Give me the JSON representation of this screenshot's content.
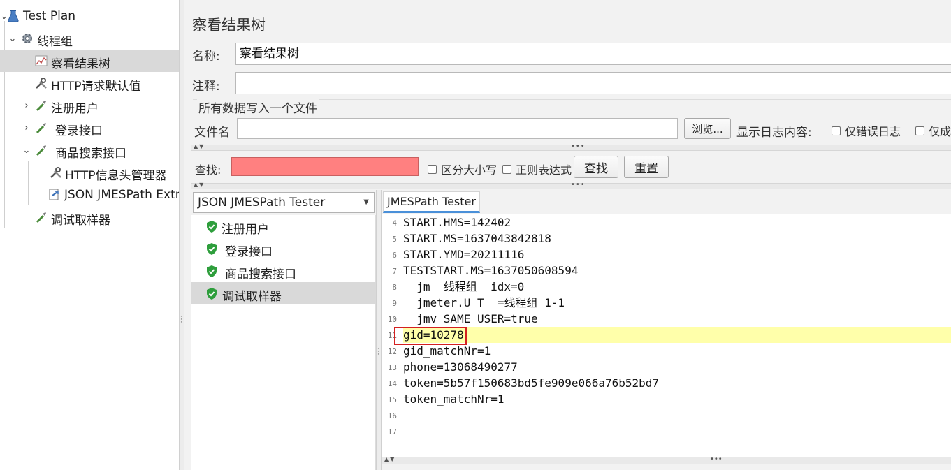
{
  "tree": {
    "items": [
      {
        "label": "Test Plan",
        "icon": "flask-icon"
      },
      {
        "label": "线程组",
        "icon": "gear-icon"
      },
      {
        "label": "察看结果树",
        "icon": "graph-icon"
      },
      {
        "label": "HTTP请求默认值",
        "icon": "wrench-icon"
      },
      {
        "label": "注册用户",
        "icon": "pipette-icon"
      },
      {
        "label": "登录接口",
        "icon": "pipette-icon"
      },
      {
        "label": "商品搜索接口",
        "icon": "pipette-icon"
      },
      {
        "label": "HTTP信息头管理器",
        "icon": "wrench-icon"
      },
      {
        "label": "JSON JMESPath Extractor",
        "icon": "extractor-icon"
      },
      {
        "label": "调试取样器",
        "icon": "pipette-icon"
      }
    ],
    "visible_labels": {
      "extractor": "JSON JMESPath Extra"
    }
  },
  "panel": {
    "title": "察看结果树",
    "name_label": "名称:",
    "name_value": "察看结果树",
    "comment_label": "注释:",
    "comment_value": "",
    "file_group_title": "所有数据写入一个文件",
    "filename_label": "文件名",
    "filename_value": "",
    "browse_button": "浏览...",
    "log_content_label": "显示日志内容:",
    "errors_only_label": "仅错误日志",
    "success_only_label": "仅成"
  },
  "search": {
    "label": "查找:",
    "value": "",
    "case_sensitive_label": "区分大小写",
    "regex_label": "正则表达式",
    "find_button": "查找",
    "reset_button": "重置"
  },
  "renderer": {
    "selected": "JSON JMESPath Tester"
  },
  "results": [
    {
      "label": "注册用户",
      "status": "success"
    },
    {
      "label": "登录接口",
      "status": "success"
    },
    {
      "label": "商品搜索接口",
      "status": "success"
    },
    {
      "label": "调试取样器",
      "status": "success"
    }
  ],
  "tester": {
    "tab_label": "JMESPath Tester",
    "lines": [
      {
        "num": "4",
        "text": "START.HMS=142402"
      },
      {
        "num": "5",
        "text": "START.MS=1637043842818"
      },
      {
        "num": "6",
        "text": "START.YMD=20211116"
      },
      {
        "num": "7",
        "text": "TESTSTART.MS=1637050608594"
      },
      {
        "num": "8",
        "text": "__jm__线程组__idx=0"
      },
      {
        "num": "9",
        "text": "__jmeter.U_T__=线程组 1-1"
      },
      {
        "num": "10",
        "text": "__jmv_SAME_USER=true"
      },
      {
        "num": "11",
        "text": "gid=10278"
      },
      {
        "num": "12",
        "text": "gid_matchNr=1"
      },
      {
        "num": "13",
        "text": "phone=13068490277"
      },
      {
        "num": "14",
        "text": "token=5b57f150683bd5fe909e066a76b52bd7"
      },
      {
        "num": "15",
        "text": "token_matchNr=1"
      },
      {
        "num": "16",
        "text": ""
      },
      {
        "num": "17",
        "text": ""
      }
    ],
    "highlight_color": "#ffffaa",
    "annotation_color": "#d42020"
  },
  "colors": {
    "search_field_bg": "#ff8080",
    "selection_bg": "#d9d9d9",
    "success_green": "#2e9e3c",
    "tab_underline": "#4a90d9"
  }
}
